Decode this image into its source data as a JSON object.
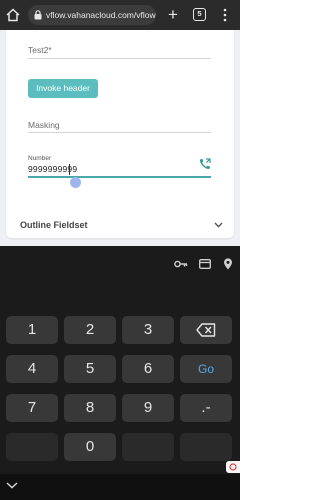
{
  "browser": {
    "url": "vflow.vahanacloud.com/vflow",
    "tab_count": "5"
  },
  "form": {
    "test_label": "Test2*",
    "invoke_button": "Invoke header",
    "masking_label": "Masking",
    "number_label": "Number",
    "number_value": "9999999999",
    "outline_title": "Outline Fieldset"
  },
  "keyboard": {
    "keys": [
      "1",
      "2",
      "3",
      "4",
      "5",
      "6",
      "7",
      "8",
      "9",
      "0"
    ],
    "go_label": "Go",
    "punct_label": ".-"
  },
  "colors": {
    "accent": "#5bbdbd",
    "go": "#5aa9e6"
  }
}
